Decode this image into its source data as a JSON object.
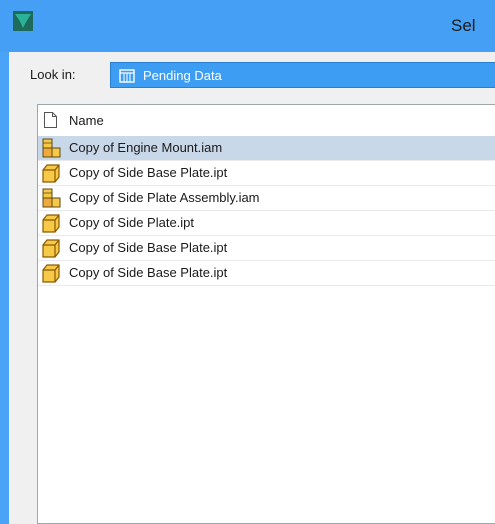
{
  "window": {
    "title": "Sel",
    "app_icon": "inventor-logo-icon"
  },
  "look_in": {
    "label": "Look in:",
    "value": "Pending Data",
    "icon": "vault-folder-icon"
  },
  "list": {
    "header": {
      "label": "Name",
      "icon": "document-icon"
    },
    "items": [
      {
        "label": "Copy of Engine Mount.iam",
        "icon": "assembly-icon",
        "selected": true
      },
      {
        "label": "Copy of Side Base Plate.ipt",
        "icon": "part-icon",
        "selected": false
      },
      {
        "label": "Copy of Side Plate Assembly.iam",
        "icon": "assembly-icon",
        "selected": false
      },
      {
        "label": "Copy of Side Plate.ipt",
        "icon": "part-icon",
        "selected": false
      },
      {
        "label": "Copy of Side Base Plate.ipt",
        "icon": "part-icon",
        "selected": false
      },
      {
        "label": "Copy of Side Base Plate.ipt",
        "icon": "part-icon",
        "selected": false
      }
    ]
  },
  "colors": {
    "titlebar": "#45a0f5",
    "selection": "#c9d8e8",
    "combo": "#3d9df3"
  }
}
